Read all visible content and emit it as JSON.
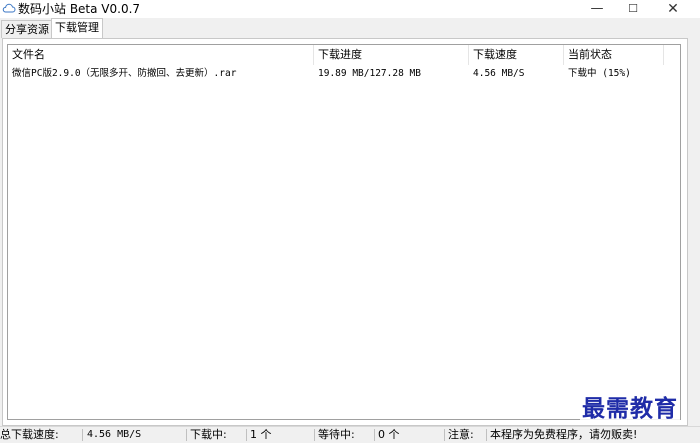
{
  "window": {
    "title": "数码小站 Beta V0.0.7",
    "app_icon": "cloud-icon",
    "controls": {
      "minimize": "—",
      "maximize": "☐",
      "close": "✕"
    }
  },
  "tabs": [
    {
      "label": "分享资源",
      "active": false
    },
    {
      "label": "下载管理",
      "active": true
    }
  ],
  "downloads": {
    "columns": [
      "文件名",
      "下载进度",
      "下载速度",
      "当前状态"
    ],
    "rows": [
      {
        "filename": "微信PC版2.9.0（无限多开、防撤回、去更新）.rar",
        "progress": "19.89 MB/127.28 MB",
        "speed": "4.56 MB/S",
        "status": "下载中 (15%)"
      }
    ]
  },
  "statusbar": {
    "total_speed_label": "总下载速度:",
    "total_speed_value": "4.56 MB/S",
    "downloading_label": "下载中:",
    "downloading_value": "1 个",
    "waiting_label": "等待中:",
    "waiting_value": "0 个",
    "notice_label": "注意:",
    "notice_value": "本程序为免费程序，请勿贩卖!"
  },
  "watermark": "最需教育",
  "colors": {
    "accent": "#1f2ca8"
  }
}
